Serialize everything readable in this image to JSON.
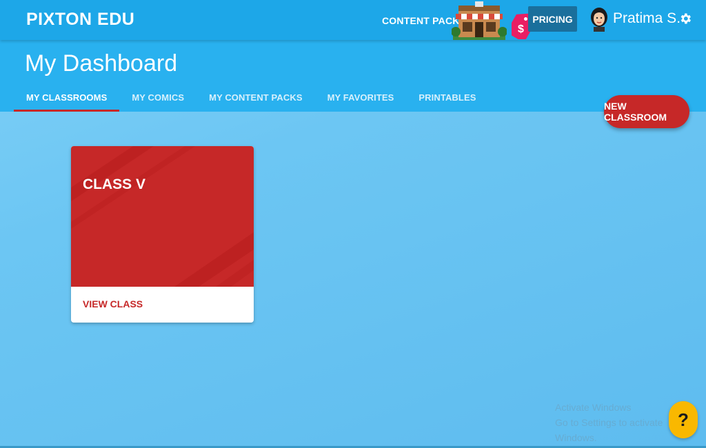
{
  "topbar": {
    "brand": "PIXTON EDU",
    "content_packs_label": "CONTENT PACKS",
    "pricing_label": "PRICING",
    "price_tag_symbol": "$",
    "user_name": "Pratima S."
  },
  "header": {
    "title": "My Dashboard",
    "tabs": [
      {
        "label": "MY CLASSROOMS",
        "active": true
      },
      {
        "label": "MY COMICS",
        "active": false
      },
      {
        "label": "MY CONTENT PACKS",
        "active": false
      },
      {
        "label": "MY FAVORITES",
        "active": false
      },
      {
        "label": "PRINTABLES",
        "active": false
      }
    ]
  },
  "actions": {
    "new_classroom_label": "NEW CLASSROOM"
  },
  "classrooms": [
    {
      "name": "CLASS V",
      "link_label": "VIEW CLASS"
    }
  ],
  "watermark": {
    "line1": "Activate Windows",
    "line2": "Go to Settings to activate Windows."
  },
  "help": {
    "label": "?"
  },
  "colors": {
    "topbar": "#1da7e8",
    "header": "#29b1ef",
    "accent_red": "#c62828",
    "help_yellow": "#f9b800",
    "pricing_bg": "#1a6f9c"
  },
  "icons": [
    "store-icon",
    "price-tag-icon",
    "avatar",
    "gear-icon",
    "help-icon"
  ]
}
